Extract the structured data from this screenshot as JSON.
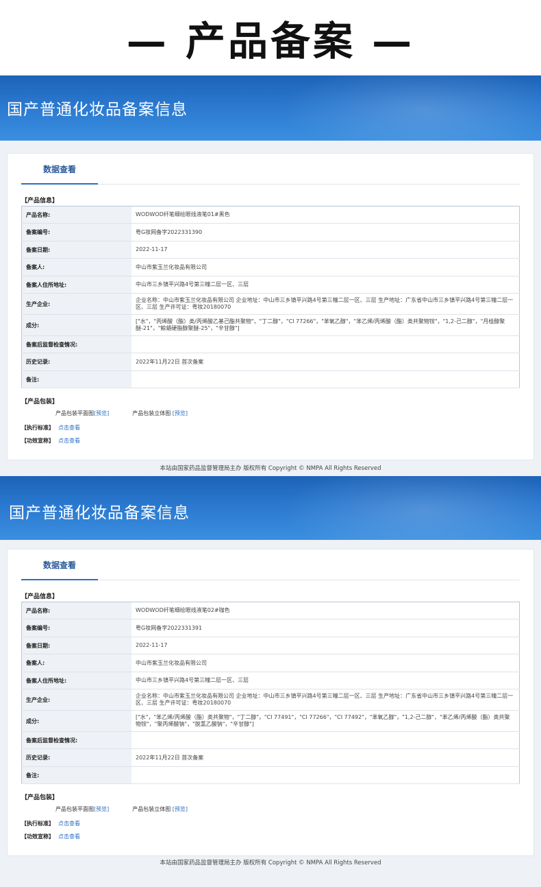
{
  "page_title": "— 产品备案 —",
  "records": [
    {
      "banner_title": "国产普通化妆品备案信息",
      "tab_label": "数据查看",
      "product_info_label": "【产品信息】",
      "rows": [
        {
          "label": "产品名称:",
          "value": "WODWOD纤笔细绘眼线液笔01#黑色"
        },
        {
          "label": "备案编号:",
          "value": "粤G妆网备字2022331390"
        },
        {
          "label": "备案日期:",
          "value": "2022-11-17"
        },
        {
          "label": "备案人:",
          "value": "中山市紫玉兰化妆品有限公司"
        },
        {
          "label": "备案人住所地址:",
          "value": "中山市三乡镇平兴路4号第三幢二层一区、三层"
        },
        {
          "label": "生产企业:",
          "value": "企业名称：中山市紫玉兰化妆品有限公司 企业地址：中山市三乡镇平兴路4号第三幢二层一区、三层 生产地址：广东省中山市三乡镇平兴路4号第三幢二层一区、三层 生产许可证：粤妆20180070"
        },
        {
          "label": "成分:",
          "value": "[\"水\"，\"丙烯酸（酯）类/丙烯酸乙基己酯共聚物\"，\"丁二醇\"，\"CI 77266\"，\"苯氧乙醇\"，\"苯乙烯/丙烯酸（酯）类共聚物铵\"，\"1,2-己二醇\"，\"月桂醇聚醚-21\"，\"鲸蜡硬脂醇聚醚-25\"，\"辛甘醇\"]"
        },
        {
          "label": "备案后监督检查情况:",
          "value": ""
        },
        {
          "label": "历史记录:",
          "value": "2022年11月22日 首次备案"
        },
        {
          "label": "备注:",
          "value": ""
        }
      ],
      "package_label": "【产品包装】",
      "package_flat": "产品包装平面图",
      "package_3d": "产品包装立体图",
      "preview_link": "[预览]",
      "standard_label": "【执行标准】",
      "efficacy_label": "【功效宣称】",
      "view_link": "点击查看",
      "footer": "本站由国家药品监督管理局主办 版权所有 Copyright © NMPA All Rights Reserved"
    },
    {
      "banner_title": "国产普通化妆品备案信息",
      "tab_label": "数据查看",
      "product_info_label": "【产品信息】",
      "rows": [
        {
          "label": "产品名称:",
          "value": "WODWOD纤笔细绘眼线液笔02#咖色"
        },
        {
          "label": "备案编号:",
          "value": "粤G妆网备字2022331391"
        },
        {
          "label": "备案日期:",
          "value": "2022-11-17"
        },
        {
          "label": "备案人:",
          "value": "中山市紫玉兰化妆品有限公司"
        },
        {
          "label": "备案人住所地址:",
          "value": "中山市三乡镇平兴路4号第三幢二层一区、三层"
        },
        {
          "label": "生产企业:",
          "value": "企业名称：中山市紫玉兰化妆品有限公司 企业地址：中山市三乡镇平兴路4号第三幢二层一区、三层 生产地址：广东省中山市三乡镇平兴路4号第三幢二层一区、三层 生产许可证：粤妆20180070"
        },
        {
          "label": "成分:",
          "value": "[\"水\"，\"苯乙烯/丙烯酸（酯）类共聚物\"，\"丁二醇\"，\"CI 77491\"，\"CI 77266\"，\"CI 77492\"，\"苯氧乙醇\"，\"1,2-己二醇\"，\"苯乙烯/丙烯酸（酯）类共聚物铵\"，\"聚丙烯酸钠\"，\"脱氢乙酸钠\"，\"辛甘醇\"]"
        },
        {
          "label": "备案后监督检查情况:",
          "value": ""
        },
        {
          "label": "历史记录:",
          "value": "2022年11月22日 首次备案"
        },
        {
          "label": "备注:",
          "value": ""
        }
      ],
      "package_label": "【产品包装】",
      "package_flat": "产品包装平面图",
      "package_3d": "产品包装立体图",
      "preview_link": "[预览]",
      "standard_label": "【执行标准】",
      "efficacy_label": "【功效宣称】",
      "view_link": "点击查看",
      "footer": "本站由国家药品监督管理局主办 版权所有 Copyright © NMPA All Rights Reserved"
    }
  ]
}
